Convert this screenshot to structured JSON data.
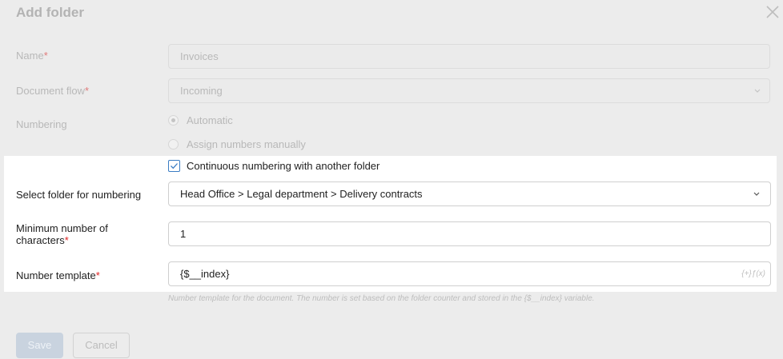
{
  "dialog": {
    "title": "Add folder",
    "close_icon": "close-icon"
  },
  "form": {
    "name": {
      "label": "Name",
      "required_mark": "*",
      "value": "Invoices"
    },
    "document_flow": {
      "label": "Document flow",
      "required_mark": "*",
      "value": "Incoming",
      "icon": "chevron-down-icon"
    },
    "numbering": {
      "label": "Numbering",
      "options": [
        {
          "label": "Automatic",
          "selected": true
        },
        {
          "label": "Assign numbers manually",
          "selected": false
        }
      ]
    },
    "continuous": {
      "label": "Continuous numbering with another folder",
      "checked": true
    },
    "select_folder": {
      "label": "Select folder for numbering",
      "value": "Head Office > Legal department > Delivery contracts",
      "icon": "chevron-down-icon"
    },
    "min_chars": {
      "label_line1": "Minimum number of",
      "label_line2": "characters",
      "required_mark": "*",
      "value": "1"
    },
    "number_template": {
      "label": "Number template",
      "required_mark": "*",
      "value": "{$__index}",
      "tools": "{+}ƒ(x)"
    },
    "hint": "Number template for the document. The number is set based on the folder counter and stored in the {$__index} variable."
  },
  "buttons": {
    "save": "Save",
    "cancel": "Cancel"
  },
  "colors": {
    "accent": "#3b7dc4",
    "required": "#e02020",
    "overlay": "#ececec"
  }
}
